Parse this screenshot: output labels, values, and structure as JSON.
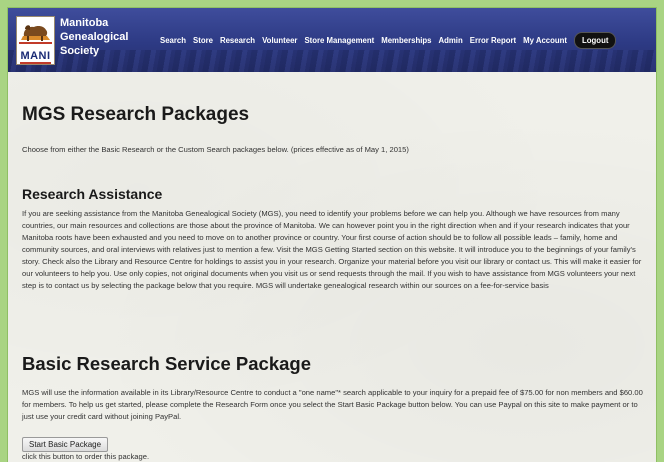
{
  "brand": {
    "logo_text": "MANI",
    "name_lines": [
      "Manitoba",
      "Genealogical",
      "Society"
    ]
  },
  "nav": {
    "items": [
      "Search",
      "Store",
      "Research",
      "Volunteer",
      "Store Management",
      "Memberships",
      "Admin",
      "Error Report",
      "My Account"
    ],
    "logout_label": "Logout"
  },
  "page": {
    "title": "MGS Research Packages",
    "intro": "Choose from either the Basic Research or the Custom Search packages below. (prices effective as of May 1, 2015)",
    "assistance_heading": "Research Assistance",
    "assistance_text": "If you are seeking assistance from the Manitoba Genealogical Society (MGS), you need to identify your problems before we can help you. Although we have resources from many countries, our main resources and collections are those about the province of Manitoba. We can however point you in the right direction when and if your research indicates that your Manitoba roots have been exhausted and you need to move on to another province or country. Your first course of action should be to follow all possible leads – family, home and community sources, and oral interviews with relatives just to mention a few. Visit the MGS Getting Started section on this website. It will introduce you to the beginnings of your family's story. Check also the Library and Resource Centre for holdings to assist you in your research. Organize your material before you visit our library or contact us. This will make it easier for our volunteers to help you. Use only copies, not original documents when you visit us or send requests through the mail. If you wish to have assistance from MGS volunteers your next step is to contact us by selecting the package below that you require. MGS will undertake genealogical research within our sources on a fee-for-service basis",
    "basic_heading": "Basic Research Service Package",
    "basic_text": "MGS will use the information available in its Library/Resource Centre to conduct a \"one name\"* search applicable to your inquiry for a prepaid fee of $75.00 for non members and $60.00 for members. To help us get started, please complete the Research Form once you select the Start Basic Package button below. You can use Paypal on this site to make payment or to just use your credit card without joining PayPal.",
    "start_button": "Start Basic Package",
    "start_hint": "click this button to order this package."
  },
  "colors": {
    "header_blue": "#2d3a84",
    "page_border_green": "#a9d483",
    "logout_bg": "#111111"
  }
}
